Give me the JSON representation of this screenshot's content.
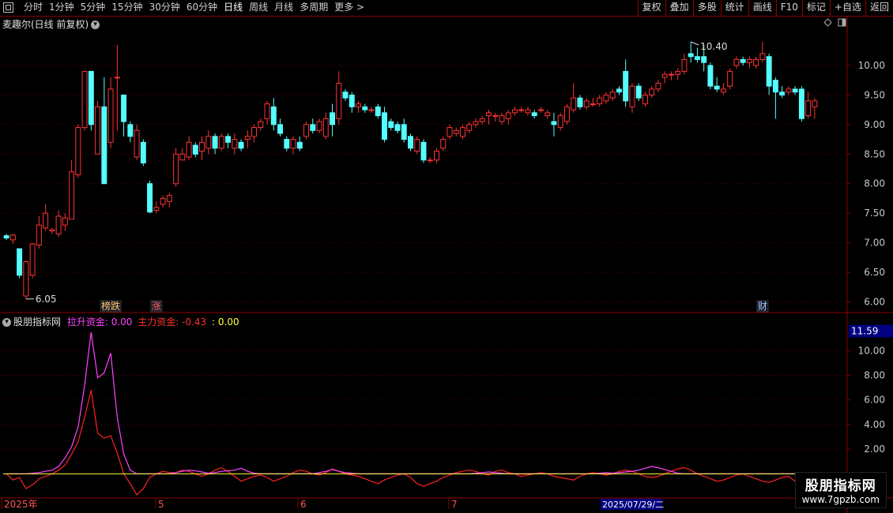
{
  "toolbar": {
    "periods": [
      "分时",
      "1分钟",
      "5分钟",
      "15分钟",
      "30分钟",
      "60分钟",
      "日线",
      "周线",
      "月线",
      "多周期",
      "更多 >"
    ],
    "buttons": [
      "复权",
      "叠加",
      "多股",
      "统计",
      "画线",
      "F10",
      "标记",
      "+自选",
      "返回"
    ]
  },
  "main_pane": {
    "title": "麦趣尔(日线 前复权)",
    "y_ticks": [
      "10.00",
      "9.50",
      "9.00",
      "8.50",
      "8.00",
      "7.50",
      "7.00",
      "6.50",
      "6.00"
    ],
    "high_label": "10.40",
    "low_label": "6.05",
    "markers": [
      {
        "text": "榜跌",
        "color": "#ffcc66"
      },
      {
        "text": "涨",
        "color": "#ff6666"
      },
      {
        "text": "财",
        "color": "#9ec7ff"
      }
    ]
  },
  "indicator_pane": {
    "name": "股朋指标网",
    "l1_label": "拉升资金:",
    "l1_value": "0.00",
    "l2_label": "主力资金:",
    "l2_value": "-0.43",
    "l3_value": ": 0.00",
    "max_value": "11.59",
    "y_ticks": [
      "10.00",
      "8.00",
      "6.00",
      "4.00",
      "2.00"
    ]
  },
  "date_axis": {
    "labels": [
      "2025年",
      "5",
      "6",
      "7"
    ],
    "cursor_date": "2025/07/29/二"
  },
  "watermark": {
    "title": "股朋指标网",
    "url": "www.7gpzb.com"
  },
  "colors": {
    "up": "#ff3333",
    "down": "#54ffff",
    "lift": "#ff44ff",
    "main": "#ff2222",
    "zero": "#ffff44",
    "axis": "#8b0000"
  },
  "chart_data": {
    "type": "candlestick",
    "price_range": [
      5.9,
      10.6
    ],
    "candles": [
      [
        7.12,
        7.15,
        7.05,
        7.08
      ],
      [
        7.05,
        7.15,
        6.98,
        7.13
      ],
      [
        6.9,
        6.9,
        6.4,
        6.45
      ],
      [
        6.1,
        6.7,
        6.05,
        6.68
      ],
      [
        6.45,
        7.0,
        6.4,
        6.98
      ],
      [
        6.96,
        7.45,
        6.9,
        7.3
      ],
      [
        7.25,
        7.65,
        7.2,
        7.5
      ],
      [
        7.2,
        7.25,
        7.15,
        7.22
      ],
      [
        7.15,
        7.55,
        7.1,
        7.45
      ],
      [
        7.3,
        7.5,
        7.2,
        7.42
      ],
      [
        7.4,
        8.4,
        7.4,
        8.2
      ],
      [
        8.15,
        9.0,
        8.1,
        8.95
      ],
      [
        8.95,
        9.9,
        8.9,
        9.9
      ],
      [
        9.9,
        9.9,
        8.9,
        9.0
      ],
      [
        8.5,
        9.4,
        8.5,
        9.3
      ],
      [
        9.3,
        9.8,
        8.0,
        8.0
      ],
      [
        8.7,
        9.8,
        8.6,
        9.6
      ],
      [
        9.8,
        10.35,
        8.9,
        9.8
      ],
      [
        9.5,
        9.5,
        8.8,
        9.05
      ],
      [
        9.0,
        9.05,
        8.7,
        8.8
      ],
      [
        8.45,
        9.0,
        8.4,
        8.9
      ],
      [
        8.7,
        8.75,
        8.3,
        8.35
      ],
      [
        8.0,
        8.05,
        7.5,
        7.52
      ],
      [
        7.55,
        7.7,
        7.5,
        7.6
      ],
      [
        7.65,
        7.8,
        7.6,
        7.75
      ],
      [
        7.7,
        7.85,
        7.6,
        7.8
      ],
      [
        8.0,
        8.6,
        7.95,
        8.5
      ],
      [
        8.4,
        8.6,
        8.4,
        8.5
      ],
      [
        8.45,
        8.8,
        8.4,
        8.7
      ],
      [
        8.65,
        8.7,
        8.45,
        8.5
      ],
      [
        8.55,
        8.8,
        8.4,
        8.7
      ],
      [
        8.6,
        8.9,
        8.5,
        8.8
      ],
      [
        8.8,
        8.85,
        8.5,
        8.6
      ],
      [
        8.6,
        8.85,
        8.55,
        8.8
      ],
      [
        8.8,
        8.85,
        8.6,
        8.7
      ],
      [
        8.6,
        8.85,
        8.5,
        8.75
      ],
      [
        8.7,
        8.75,
        8.55,
        8.6
      ],
      [
        8.75,
        8.9,
        8.6,
        8.8
      ],
      [
        8.8,
        9.0,
        8.7,
        8.95
      ],
      [
        8.95,
        9.1,
        8.9,
        9.05
      ],
      [
        9.1,
        9.4,
        9.0,
        9.35
      ],
      [
        9.3,
        9.45,
        8.9,
        9.0
      ],
      [
        9.0,
        9.1,
        8.8,
        8.85
      ],
      [
        8.75,
        8.8,
        8.55,
        8.6
      ],
      [
        8.6,
        8.8,
        8.5,
        8.75
      ],
      [
        8.7,
        8.8,
        8.55,
        8.6
      ],
      [
        8.8,
        9.05,
        8.75,
        9.0
      ],
      [
        9.0,
        9.1,
        8.85,
        8.9
      ],
      [
        8.9,
        9.1,
        8.85,
        9.05
      ],
      [
        8.8,
        9.2,
        8.75,
        9.1
      ],
      [
        9.2,
        9.35,
        8.8,
        9.0
      ],
      [
        9.1,
        9.9,
        9.0,
        9.7
      ],
      [
        9.55,
        9.6,
        9.4,
        9.45
      ],
      [
        9.5,
        9.55,
        9.2,
        9.3
      ],
      [
        9.3,
        9.4,
        9.2,
        9.35
      ],
      [
        9.3,
        9.35,
        9.2,
        9.25
      ],
      [
        9.25,
        9.3,
        9.2,
        9.25
      ],
      [
        9.3,
        9.35,
        9.1,
        9.15
      ],
      [
        9.2,
        9.3,
        8.7,
        8.75
      ],
      [
        9.05,
        9.1,
        8.9,
        8.95
      ],
      [
        9.0,
        9.05,
        8.85,
        8.9
      ],
      [
        9.0,
        9.1,
        8.7,
        8.75
      ],
      [
        8.8,
        8.85,
        8.55,
        8.6
      ],
      [
        8.55,
        8.8,
        8.5,
        8.75
      ],
      [
        8.7,
        8.75,
        8.35,
        8.4
      ],
      [
        8.4,
        8.45,
        8.35,
        8.4
      ],
      [
        8.4,
        8.6,
        8.35,
        8.55
      ],
      [
        8.6,
        8.8,
        8.55,
        8.75
      ],
      [
        8.8,
        9.0,
        8.75,
        8.95
      ],
      [
        8.85,
        8.95,
        8.8,
        8.9
      ],
      [
        8.8,
        9.0,
        8.75,
        8.95
      ],
      [
        8.9,
        9.05,
        8.85,
        9.0
      ],
      [
        9.0,
        9.1,
        8.95,
        9.05
      ],
      [
        9.05,
        9.15,
        9.0,
        9.1
      ],
      [
        9.15,
        9.25,
        9.0,
        9.2
      ],
      [
        9.15,
        9.2,
        9.05,
        9.15
      ],
      [
        9.05,
        9.2,
        9.0,
        9.15
      ],
      [
        9.1,
        9.25,
        9.0,
        9.2
      ],
      [
        9.2,
        9.3,
        9.15,
        9.25
      ],
      [
        9.25,
        9.3,
        9.2,
        9.25
      ],
      [
        9.2,
        9.3,
        9.15,
        9.25
      ],
      [
        9.2,
        9.25,
        9.1,
        9.15
      ],
      [
        9.25,
        9.3,
        9.2,
        9.25
      ],
      [
        9.15,
        9.25,
        9.1,
        9.2
      ],
      [
        9.05,
        9.2,
        8.8,
        9.0
      ],
      [
        8.95,
        9.2,
        8.9,
        9.15
      ],
      [
        9.05,
        9.35,
        9.0,
        9.3
      ],
      [
        9.25,
        9.7,
        9.2,
        9.45
      ],
      [
        9.45,
        9.5,
        9.25,
        9.3
      ],
      [
        9.3,
        9.45,
        9.25,
        9.4
      ],
      [
        9.35,
        9.45,
        9.3,
        9.35
      ],
      [
        9.35,
        9.5,
        9.3,
        9.45
      ],
      [
        9.4,
        9.55,
        9.35,
        9.5
      ],
      [
        9.45,
        9.6,
        9.4,
        9.55
      ],
      [
        9.6,
        9.65,
        9.5,
        9.55
      ],
      [
        9.9,
        10.1,
        9.3,
        9.4
      ],
      [
        9.3,
        9.7,
        9.2,
        9.65
      ],
      [
        9.65,
        9.7,
        9.4,
        9.45
      ],
      [
        9.35,
        9.55,
        9.3,
        9.5
      ],
      [
        9.5,
        9.65,
        9.45,
        9.6
      ],
      [
        9.6,
        9.75,
        9.55,
        9.7
      ],
      [
        9.8,
        9.9,
        9.7,
        9.85
      ],
      [
        9.85,
        9.9,
        9.75,
        9.85
      ],
      [
        9.85,
        9.95,
        9.75,
        9.9
      ],
      [
        9.9,
        10.2,
        9.85,
        10.1
      ],
      [
        10.2,
        10.4,
        10.05,
        10.15
      ],
      [
        10.15,
        10.3,
        10.05,
        10.1
      ],
      [
        10.15,
        10.35,
        9.9,
        10.05
      ],
      [
        10.0,
        10.05,
        9.6,
        9.65
      ],
      [
        9.65,
        9.8,
        9.55,
        9.6
      ],
      [
        9.55,
        9.7,
        9.5,
        9.6
      ],
      [
        9.65,
        9.95,
        9.6,
        9.9
      ],
      [
        10.0,
        10.15,
        9.95,
        10.1
      ],
      [
        10.1,
        10.15,
        10.0,
        10.05
      ],
      [
        10.05,
        10.15,
        9.95,
        10.1
      ],
      [
        10.0,
        10.15,
        9.95,
        10.1
      ],
      [
        10.1,
        10.4,
        10.05,
        10.2
      ],
      [
        10.15,
        10.2,
        9.5,
        9.65
      ],
      [
        9.75,
        9.8,
        9.1,
        9.55
      ],
      [
        9.55,
        9.65,
        9.45,
        9.5
      ],
      [
        9.55,
        9.65,
        9.5,
        9.6
      ],
      [
        9.6,
        9.65,
        9.5,
        9.55
      ],
      [
        9.6,
        9.65,
        9.05,
        9.1
      ],
      [
        9.15,
        9.55,
        9.1,
        9.4
      ],
      [
        9.3,
        9.45,
        9.1,
        9.4
      ]
    ],
    "indicator": {
      "range": [
        -1.9,
        12.2
      ],
      "lift": [
        0,
        0,
        0,
        0,
        0.05,
        0.1,
        0.2,
        0.3,
        0.6,
        1.3,
        2.2,
        3.8,
        7.2,
        11.5,
        7.8,
        8.2,
        9.8,
        4.6,
        1.6,
        0.3,
        0,
        0,
        0,
        0,
        0,
        0,
        0.1,
        0.2,
        0.3,
        0.25,
        0.15,
        0.05,
        0.1,
        0.2,
        0.25,
        0.3,
        0.45,
        0.2,
        0.05,
        0,
        0,
        0,
        0,
        0,
        0,
        0,
        0,
        0,
        0.1,
        0.2,
        0.35,
        0.2,
        0.1,
        0.05,
        0,
        0,
        0,
        0,
        0,
        0,
        0,
        0,
        0,
        0,
        0,
        0,
        0,
        0,
        0,
        0,
        0,
        0,
        0.05,
        0.1,
        0.15,
        0.1,
        0.05,
        0,
        0,
        0,
        0,
        0,
        0,
        0,
        0,
        0,
        0,
        0,
        0,
        0,
        0,
        0.05,
        0.1,
        0.05,
        0.1,
        0.15,
        0.2,
        0.3,
        0.45,
        0.6,
        0.5,
        0.35,
        0.2,
        0.05,
        0,
        0,
        0,
        0,
        0,
        0,
        0,
        0,
        0,
        0,
        0,
        0,
        0,
        0,
        0,
        0,
        0,
        0,
        0,
        0,
        0,
        0,
        0
      ],
      "main": [
        0,
        -0.5,
        -0.3,
        -1.2,
        -0.9,
        -0.4,
        -0.2,
        0,
        0.3,
        0.7,
        1.6,
        2.6,
        4.6,
        6.8,
        3.3,
        2.9,
        3.1,
        1.7,
        0,
        -0.8,
        -1.7,
        -1.2,
        -0.3,
        0,
        0.2,
        0.1,
        0.1,
        0.3,
        0.2,
        0,
        -0.2,
        0,
        0.3,
        0.5,
        0.2,
        -0.2,
        -0.6,
        -0.4,
        -0.2,
        -0.1,
        -0.3,
        -0.6,
        -0.4,
        -0.2,
        0.1,
        0.3,
        0.2,
        0,
        -0.1,
        0.1,
        0.4,
        0.2,
        0,
        -0.1,
        -0.2,
        -0.4,
        -0.6,
        -0.8,
        -0.5,
        -0.3,
        -0.1,
        0,
        -0.3,
        -0.8,
        -1.0,
        -0.8,
        -0.6,
        -0.3,
        -0.1,
        0.1,
        0.2,
        0.3,
        0.2,
        0,
        -0.1,
        0.2,
        0.3,
        0.1,
        0,
        -0.2,
        -0.1,
        0,
        0.1,
        0,
        -0.2,
        -0.3,
        -0.4,
        -0.5,
        -0.2,
        0,
        0.1,
        0,
        -0.1,
        0,
        0.2,
        0.3,
        0.2,
        0,
        -0.2,
        -0.3,
        -0.2,
        0,
        0.2,
        0.4,
        0.5,
        0.3,
        0,
        -0.2,
        -0.4,
        -0.6,
        -0.5,
        -0.3,
        -0.1,
        0,
        -0.2,
        -0.4,
        -0.6,
        -0.7,
        -0.5,
        -0.3,
        -0.2,
        -0.6,
        -0.9,
        -1.1,
        -1.0,
        -0.9
      ],
      "zero": 0
    }
  }
}
